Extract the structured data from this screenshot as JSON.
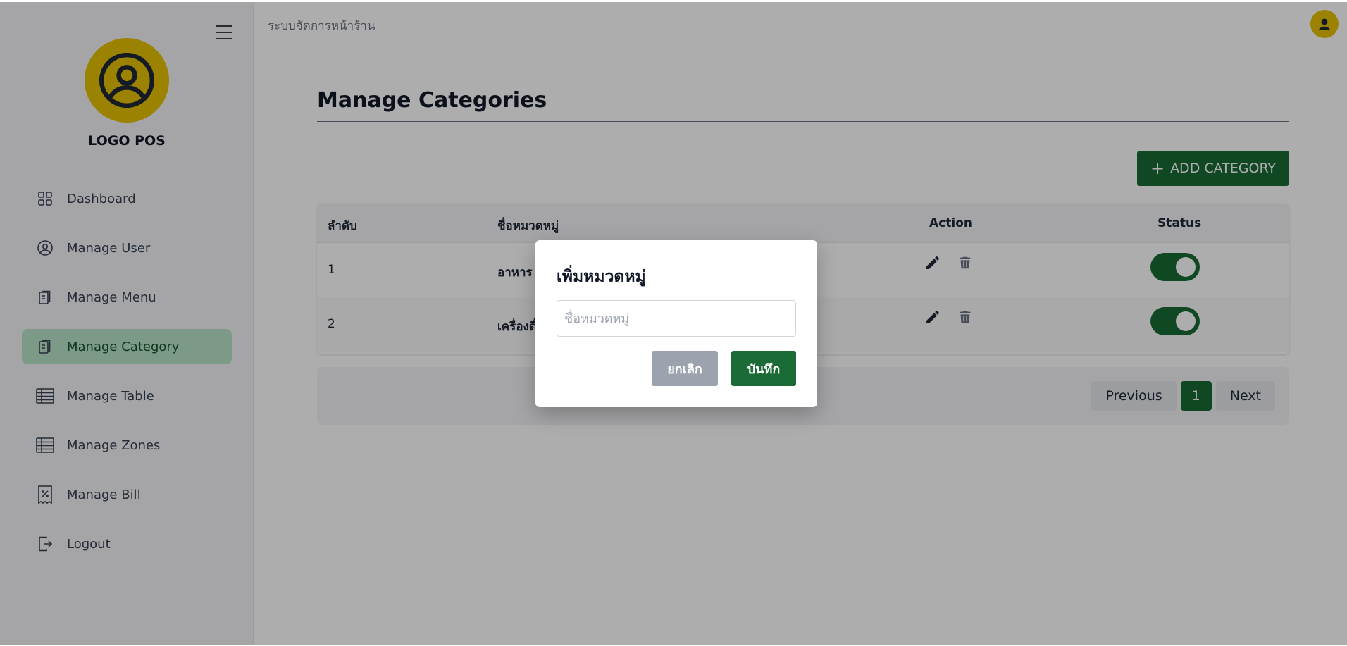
{
  "colors": {
    "accent": "#1a6b35",
    "logo": "#e5c000",
    "active_nav_bg": "#b7e4c7",
    "cancel": "#9ca3af"
  },
  "sidebar": {
    "logo_text": "LOGO POS",
    "items": [
      {
        "label": "Dashboard",
        "icon": "grid-icon",
        "active": false
      },
      {
        "label": "Manage User",
        "icon": "user-circle-icon",
        "active": false
      },
      {
        "label": "Manage Menu",
        "icon": "clipboard-copy-icon",
        "active": false
      },
      {
        "label": "Manage Category",
        "icon": "clipboard-copy-icon",
        "active": true
      },
      {
        "label": "Manage Table",
        "icon": "table-icon",
        "active": false
      },
      {
        "label": "Manage Zones",
        "icon": "table-icon",
        "active": false
      },
      {
        "label": "Manage Bill",
        "icon": "receipt-icon",
        "active": false
      },
      {
        "label": "Logout",
        "icon": "logout-icon",
        "active": false
      }
    ]
  },
  "topbar": {
    "title": "ระบบจัดการหน้าร้าน"
  },
  "main": {
    "page_title": "Manage Categories",
    "add_button_label": "ADD CATEGORY",
    "table": {
      "headers": {
        "index": "ลำดับ",
        "name": "ชื่อหมวดหมู่",
        "action": "Action",
        "status": "Status"
      },
      "rows": [
        {
          "index": "1",
          "name": "อาหาร",
          "status": true
        },
        {
          "index": "2",
          "name": "เครื่องดื่ม",
          "status": true
        }
      ]
    },
    "pagination": {
      "previous": "Previous",
      "current": "1",
      "next": "Next"
    }
  },
  "modal": {
    "title": "เพิ่มหมวดหมู่",
    "input_placeholder": "ชื่อหมวดหมู่",
    "input_value": "",
    "cancel_label": "ยกเลิก",
    "save_label": "บันทึก"
  }
}
